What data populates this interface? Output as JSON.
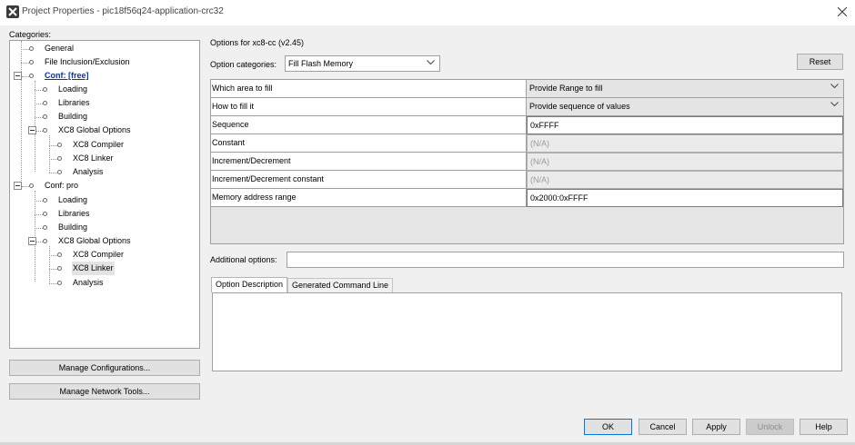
{
  "window": {
    "title": "Project Properties - pic18f56q24-application-crc32"
  },
  "categories": {
    "label": "Categories:",
    "tree": [
      {
        "label": "General"
      },
      {
        "label": "File Inclusion/Exclusion"
      },
      {
        "label": "Conf: [free]"
      },
      {
        "label": "Loading"
      },
      {
        "label": "Libraries"
      },
      {
        "label": "Building"
      },
      {
        "label": "XC8 Global Options"
      },
      {
        "label": "XC8 Compiler"
      },
      {
        "label": "XC8 Linker"
      },
      {
        "label": "Analysis"
      },
      {
        "label": "Conf: pro"
      },
      {
        "label": "Loading"
      },
      {
        "label": "Libraries"
      },
      {
        "label": "Building"
      },
      {
        "label": "XC8 Global Options"
      },
      {
        "label": "XC8 Compiler"
      },
      {
        "label": "XC8 Linker"
      },
      {
        "label": "Analysis"
      }
    ]
  },
  "left_buttons": {
    "manage_configurations": "Manage Configurations...",
    "manage_network_tools": "Manage Network Tools..."
  },
  "options": {
    "header": "Options for xc8-cc (v2.45)",
    "category_label": "Option categories:",
    "category_value": "Fill Flash Memory",
    "reset": "Reset",
    "rows": [
      {
        "name": "Which area to fill",
        "value": "Provide Range to fill"
      },
      {
        "name": "How to fill it",
        "value": "Provide sequence of values"
      },
      {
        "name": "Sequence",
        "value": "0xFFFF"
      },
      {
        "name": "Constant",
        "value": "(N/A)"
      },
      {
        "name": "Increment/Decrement",
        "value": "(N/A)"
      },
      {
        "name": "Increment/Decrement constant",
        "value": "(N/A)"
      },
      {
        "name": "Memory address range",
        "value": "0x2000:0xFFFF"
      }
    ],
    "additional_label": "Additional options:",
    "additional_value": "",
    "tabs": [
      "Option Description",
      "Generated Command Line"
    ]
  },
  "footer": {
    "ok": "OK",
    "cancel": "Cancel",
    "apply": "Apply",
    "unlock": "Unlock",
    "help": "Help"
  },
  "colors": {
    "link": "#0033cc",
    "selection": "#e3e3e3",
    "primary_border": "#0078d7"
  }
}
